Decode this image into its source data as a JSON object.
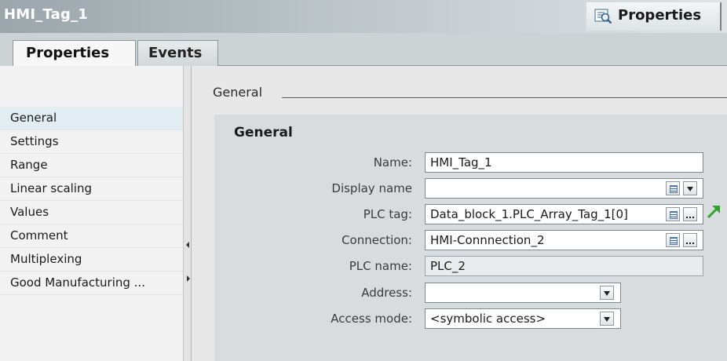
{
  "window": {
    "title": "HMI_Tag_1",
    "inspector_button": {
      "label": "Properties",
      "icon": "magnifier-properties-icon"
    }
  },
  "tabs": [
    {
      "label": "Properties",
      "selected": true
    },
    {
      "label": "Events",
      "selected": false
    }
  ],
  "sidebar": {
    "items": [
      {
        "label": "General",
        "selected": true
      },
      {
        "label": "Settings"
      },
      {
        "label": "Range"
      },
      {
        "label": "Linear scaling"
      },
      {
        "label": "Values"
      },
      {
        "label": "Comment"
      },
      {
        "label": "Multiplexing"
      },
      {
        "label": "Good Manufacturing ..."
      }
    ]
  },
  "main": {
    "section_header": "General",
    "group_title": "General",
    "fields": {
      "name": {
        "label": "Name:",
        "value": "HMI_Tag_1"
      },
      "display_name": {
        "label": "Display name",
        "value": ""
      },
      "plc_tag": {
        "label": "PLC tag:",
        "value": "Data_block_1.PLC_Array_Tag_1[0]"
      },
      "connection": {
        "label": "Connection:",
        "value": "HMI-Connnection_2"
      },
      "plc_name": {
        "label": "PLC name:",
        "value": "PLC_2"
      },
      "address": {
        "label": "Address:",
        "value": ""
      },
      "access_mode": {
        "label": "Access mode:",
        "value": "<symbolic access>"
      }
    }
  },
  "colors": {
    "titlebar_start": "#9aa6ac",
    "selected_item_bg": "#e2ecf3",
    "go_to_arrow": "#2fa32f"
  }
}
